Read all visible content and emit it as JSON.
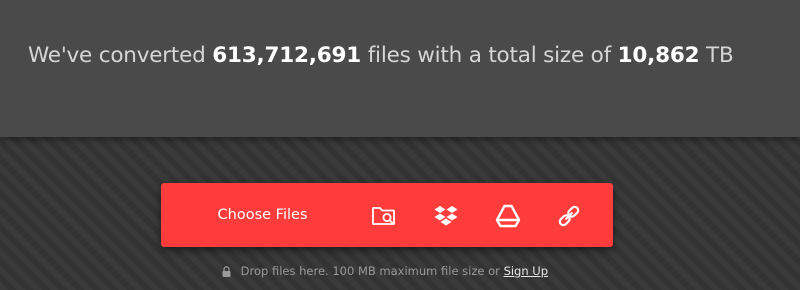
{
  "stats": {
    "prefix": "We've converted",
    "files_count": "613,712,691",
    "middle": "files with a total size of",
    "size_value": "10,862",
    "size_unit": "TB"
  },
  "upload": {
    "choose_files_label": "Choose Files",
    "sources": [
      {
        "name": "folder-search-icon"
      },
      {
        "name": "dropbox-icon"
      },
      {
        "name": "google-drive-icon"
      },
      {
        "name": "link-icon"
      }
    ],
    "accent_color": "#ff3c3c"
  },
  "footnote": {
    "lock_icon": "lock-icon",
    "text": "Drop files here. 100 MB maximum file size or",
    "signup_label": "Sign Up"
  }
}
